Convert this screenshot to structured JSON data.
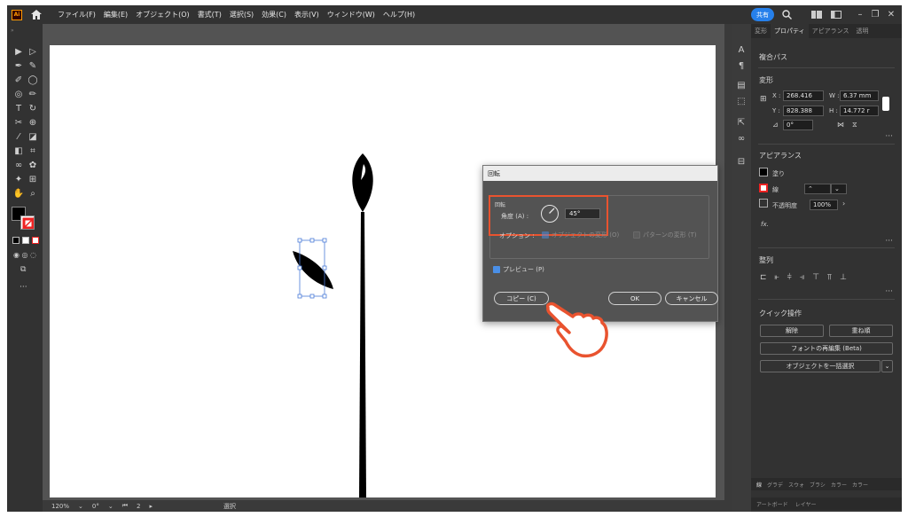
{
  "menubar": {
    "logo": "Ai",
    "items": [
      "ファイル(F)",
      "編集(E)",
      "オブジェクト(O)",
      "書式(T)",
      "選択(S)",
      "効果(C)",
      "表示(V)",
      "ウィンドウ(W)",
      "ヘルプ(H)"
    ],
    "share_label": "共有"
  },
  "status": {
    "zoom": "120%",
    "rotation": "0°",
    "artboard_num": "2",
    "mode": "選択"
  },
  "props": {
    "tabs": [
      "変形",
      "プロパティ",
      "アピアランス",
      "透明"
    ],
    "object_type": "複合パス",
    "transform_title": "変形",
    "x_label": "X :",
    "x_value": "268.416",
    "w_label": "W :",
    "w_value": "6.37 mm",
    "y_label": "Y :",
    "y_value": "828.388",
    "h_label": "H :",
    "h_value": "14.772 r",
    "angle_value": "0°",
    "appearance_title": "アピアランス",
    "fill_label": "塗り",
    "stroke_label": "線",
    "opacity_label": "不透明度",
    "opacity_value": "100%",
    "fx_label": "fx.",
    "align_title": "整列",
    "quick_title": "クイック操作",
    "release_btn": "解除",
    "arrange_btn": "重ね順",
    "font_btn": "フォントの再編集 (Beta)",
    "select_btn": "オブジェクトを一括選択",
    "bottom_tabs": [
      "線",
      "グラデ",
      "スウォ",
      "ブラシ",
      "カラー",
      "カラー"
    ],
    "bottom_tabs2": [
      "アートボード",
      "レイヤー"
    ]
  },
  "dialog": {
    "title": "回転",
    "section": "回転",
    "angle_label": "角度 (A) :",
    "angle_value": "45°",
    "options_label": "オプション :",
    "opt_objects": "オブジェクトの変形 (O)",
    "opt_patterns": "パターンの変形 (T)",
    "preview_label": "プレビュー (P)",
    "copy_btn": "コピー (C)",
    "ok_btn": "OK",
    "cancel_btn": "キャンセル"
  },
  "colors": {
    "accent": "#2680eb",
    "highlight": "#e9532f"
  }
}
